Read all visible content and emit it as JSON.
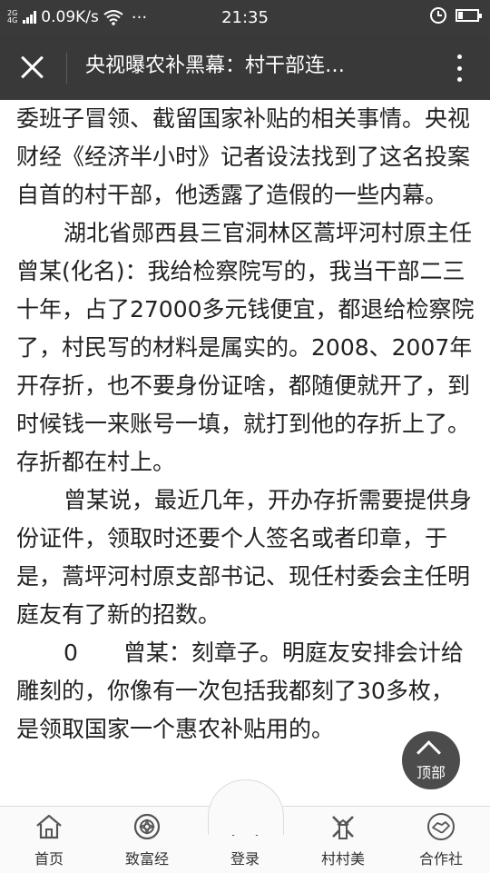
{
  "status_bar": {
    "network_top": "2G",
    "network_bottom": "4G",
    "speed": "0.09K/s",
    "dots": "···",
    "time": "21:35"
  },
  "title_bar": {
    "title": "央视曝农补黑幕：村干部连…"
  },
  "article": {
    "paragraphs": [
      {
        "text": "委班子冒领、截留国家补贴的相关事情。央视财经《经济半小时》记者设法找到了这名投案自首的村干部，他透露了造假的一些内幕。",
        "indent": false
      },
      {
        "text": "湖北省郧西县三官洞林区蒿坪河村原主任曾某(化名)：我给检察院写的，我当干部二三十年，占了27000多元钱便宜，都退给检察院了，村民写的材料是属实的。2008、2007年开存折，也不要身份证啥，都随便就开了，到时候钱一来账号一填，就打到他的存折上了。存折都在村上。",
        "indent": true
      },
      {
        "text": "曾某说，最近几年，开办存折需要提供身份证件，领取时还要个人签名或者印章，于是，蒿坪河村原支部书记、现任村委会主任明庭友有了新的招数。",
        "indent": true
      },
      {
        "text": "0　　曾某：刻章子。明庭友安排会计给雕刻的，你像有一次包括我都刻了30多枚，是领取国家一个惠农补贴用的。",
        "indent": true
      }
    ]
  },
  "back_to_top": {
    "label": "顶部"
  },
  "bottom_nav": {
    "items": [
      {
        "label": "首页",
        "icon": "home-icon"
      },
      {
        "label": "致富经",
        "icon": "compass-icon"
      },
      {
        "label": "登录",
        "icon": "user-icon"
      },
      {
        "label": "村村美",
        "icon": "windmill-icon"
      },
      {
        "label": "合作社",
        "icon": "handshake-icon"
      }
    ]
  }
}
